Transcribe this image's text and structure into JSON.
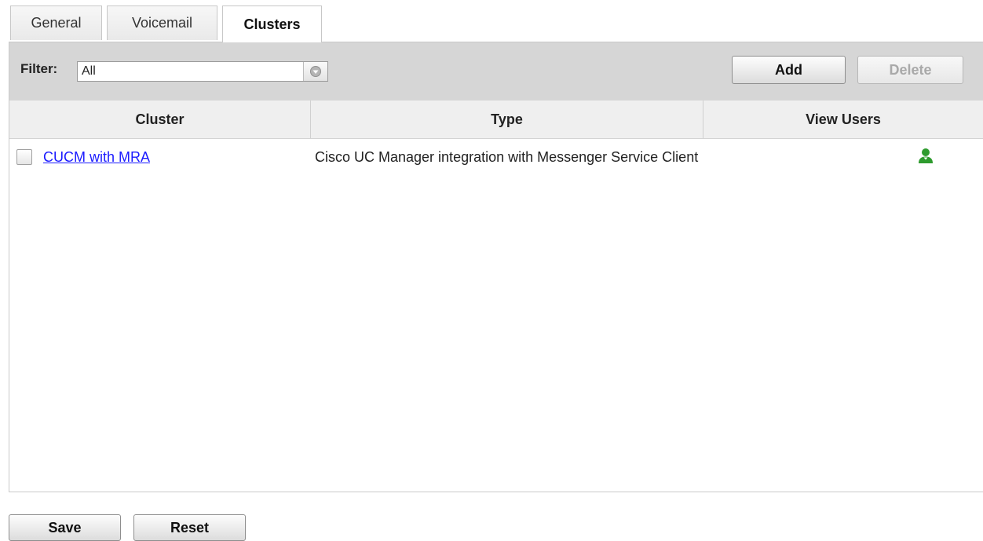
{
  "tabs": [
    {
      "label": "General",
      "active": false
    },
    {
      "label": "Voicemail",
      "active": false
    },
    {
      "label": "Clusters",
      "active": true
    }
  ],
  "toolbar": {
    "filter_label": "Filter:",
    "filter_value": "All",
    "add_label": "Add",
    "delete_label": "Delete",
    "delete_enabled": false
  },
  "table": {
    "columns": [
      "Cluster",
      "Type",
      "View Users"
    ],
    "rows": [
      {
        "checked": false,
        "cluster": "CUCM with MRA",
        "type": "Cisco UC Manager integration with Messenger Service Client",
        "view_users_icon": "user-icon"
      }
    ]
  },
  "footer": {
    "save_label": "Save",
    "reset_label": "Reset"
  },
  "colors": {
    "link": "#1a1aff",
    "user_icon": "#2e9b2e",
    "toolbar_bg": "#d6d6d6",
    "header_bg": "#efefef"
  }
}
